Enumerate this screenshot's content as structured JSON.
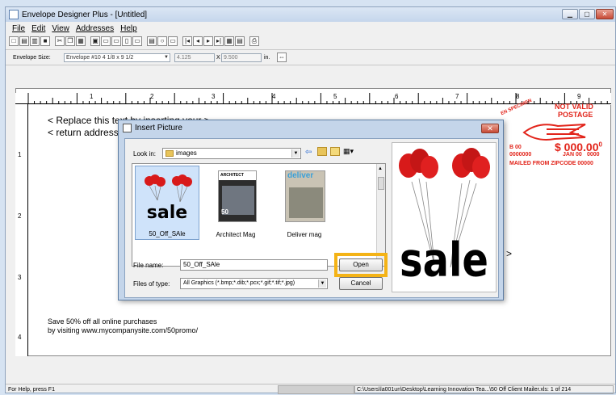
{
  "window": {
    "title": "Envelope Designer Plus - [Untitled]"
  },
  "menu": [
    "File",
    "Edit",
    "View",
    "Addresses",
    "Help"
  ],
  "envelope_bar": {
    "size_label": "Envelope Size:",
    "size_value": "Envelope #10 4 1/8 x 9 1/2",
    "width": "4.125",
    "x": "X",
    "height": "9.500",
    "unit": "in."
  },
  "ruler": {
    "marks": [
      "1",
      "2",
      "3",
      "4",
      "5",
      "6",
      "7",
      "8",
      "9"
    ],
    "side_marks": [
      "1",
      "2",
      "3",
      "4"
    ]
  },
  "canvas": {
    "return_line1": "< Replace this text by inserting your >",
    "return_line2": "< return address >",
    "right_caret": ">",
    "body_line1": "Save 50% off all online purchases",
    "body_line2": "by visiting www.mycompanysite.com/50promo/"
  },
  "postage": {
    "not_valid": "NOT VALID",
    "postage": "POSTAGE",
    "specimen": "EN SPECIMEN",
    "amount": "$ 000.00",
    "amount_sup": "0",
    "row1_left": "B 00",
    "row2_left": "0000000",
    "row2_right": "JAN 00",
    "row2_tail": "0000",
    "row3": "MAILED FROM ZIPCODE 00000"
  },
  "status": {
    "help": "For Help, press F1",
    "path": "C:\\Users\\la001un\\Desktop\\Learning Innovation Tea...\\50 Off Client Mailer.xls: 1 of 214"
  },
  "dialog": {
    "title": "Insert Picture",
    "look_in_label": "Look in:",
    "look_in_value": "images",
    "files": [
      {
        "name": "50_Off_SAle",
        "selected": true
      },
      {
        "name": "Architect Mag",
        "selected": false
      },
      {
        "name": "Deliver mag",
        "selected": false
      }
    ],
    "thumb_text": {
      "sale": "sale",
      "architect": "ARCHITECT",
      "fifty": "50",
      "deliver": "deliver"
    },
    "file_name_label": "File name:",
    "file_name_value": "50_Off_SAle",
    "file_type_label": "Files of type:",
    "file_type_value": "All Graphics (*.bmp;*.dib;*.pcx;*.gif;*.tif;*.jpg)",
    "open_label": "Open",
    "cancel_label": "Cancel",
    "preview_text": "sale"
  },
  "colors": {
    "highlight": "#f4b316",
    "postage_red": "#e2251b",
    "balloon_red": "#d81a1a"
  }
}
